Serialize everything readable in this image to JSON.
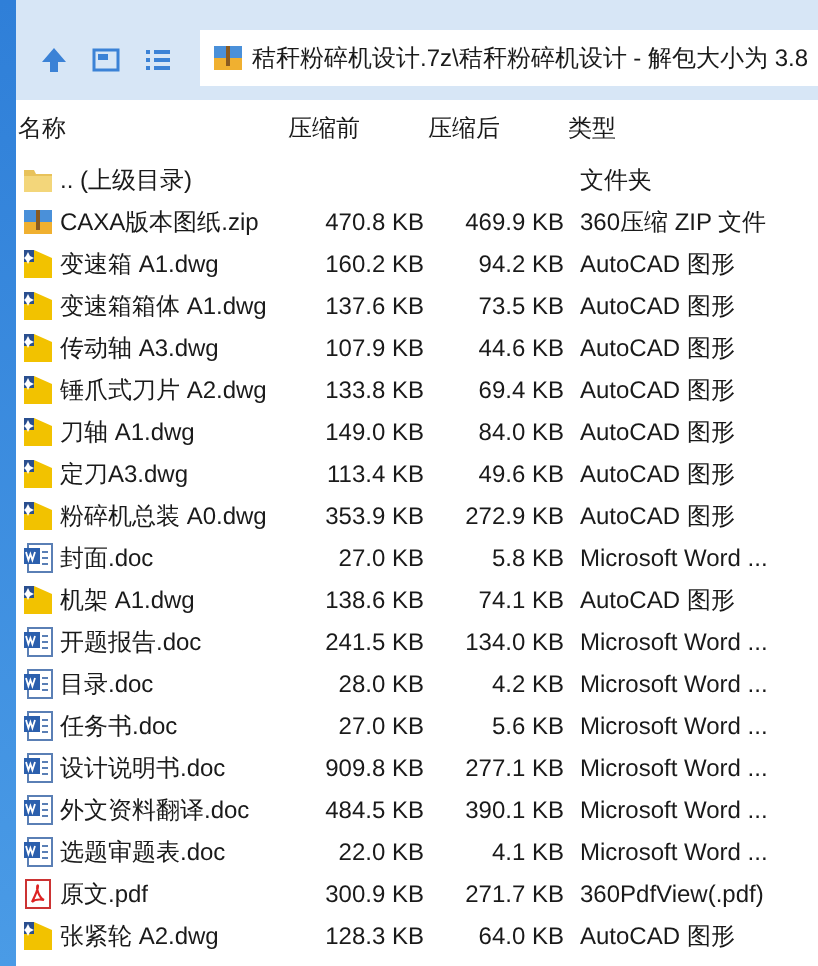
{
  "address": {
    "path": "秸秆粉碎机设计.7z\\秸秆粉碎机设计 - 解包大小为 3.8"
  },
  "columns": [
    "名称",
    "压缩前",
    "压缩后",
    "类型"
  ],
  "rows": [
    {
      "kind": "folder",
      "name": ".. (上级目录)",
      "type": "文件夹"
    },
    {
      "kind": "zip",
      "name": "CAXA版本图纸.zip",
      "before": "470.8 KB",
      "after": "469.9 KB",
      "type": "360压缩 ZIP 文件"
    },
    {
      "kind": "dwg",
      "name": "变速箱 A1.dwg",
      "before": "160.2 KB",
      "after": "94.2 KB",
      "type": "AutoCAD 图形"
    },
    {
      "kind": "dwg",
      "name": "变速箱箱体 A1.dwg",
      "before": "137.6 KB",
      "after": "73.5 KB",
      "type": "AutoCAD 图形"
    },
    {
      "kind": "dwg",
      "name": "传动轴 A3.dwg",
      "before": "107.9 KB",
      "after": "44.6 KB",
      "type": "AutoCAD 图形"
    },
    {
      "kind": "dwg",
      "name": "锤爪式刀片 A2.dwg",
      "before": "133.8 KB",
      "after": "69.4 KB",
      "type": "AutoCAD 图形"
    },
    {
      "kind": "dwg",
      "name": "刀轴 A1.dwg",
      "before": "149.0 KB",
      "after": "84.0 KB",
      "type": "AutoCAD 图形"
    },
    {
      "kind": "dwg",
      "name": "定刀A3.dwg",
      "before": "113.4 KB",
      "after": "49.6 KB",
      "type": "AutoCAD 图形"
    },
    {
      "kind": "dwg",
      "name": "粉碎机总装 A0.dwg",
      "before": "353.9 KB",
      "after": "272.9 KB",
      "type": "AutoCAD 图形"
    },
    {
      "kind": "doc",
      "name": "封面.doc",
      "before": "27.0 KB",
      "after": "5.8 KB",
      "type": "Microsoft Word ..."
    },
    {
      "kind": "dwg",
      "name": "机架 A1.dwg",
      "before": "138.6 KB",
      "after": "74.1 KB",
      "type": "AutoCAD 图形"
    },
    {
      "kind": "doc",
      "name": "开题报告.doc",
      "before": "241.5 KB",
      "after": "134.0 KB",
      "type": "Microsoft Word ..."
    },
    {
      "kind": "doc",
      "name": "目录.doc",
      "before": "28.0 KB",
      "after": "4.2 KB",
      "type": "Microsoft Word ..."
    },
    {
      "kind": "doc",
      "name": "任务书.doc",
      "before": "27.0 KB",
      "after": "5.6 KB",
      "type": "Microsoft Word ..."
    },
    {
      "kind": "doc",
      "name": "设计说明书.doc",
      "before": "909.8 KB",
      "after": "277.1 KB",
      "type": "Microsoft Word ..."
    },
    {
      "kind": "doc",
      "name": "外文资料翻译.doc",
      "before": "484.5 KB",
      "after": "390.1 KB",
      "type": "Microsoft Word ..."
    },
    {
      "kind": "doc",
      "name": "选题审题表.doc",
      "before": "22.0 KB",
      "after": "4.1 KB",
      "type": "Microsoft Word ..."
    },
    {
      "kind": "pdf",
      "name": "原文.pdf",
      "before": "300.9 KB",
      "after": "271.7 KB",
      "type": "360PdfView(.pdf)"
    },
    {
      "kind": "dwg",
      "name": "张紧轮 A2.dwg",
      "before": "128.3 KB",
      "after": "64.0 KB",
      "type": "AutoCAD 图形"
    }
  ]
}
